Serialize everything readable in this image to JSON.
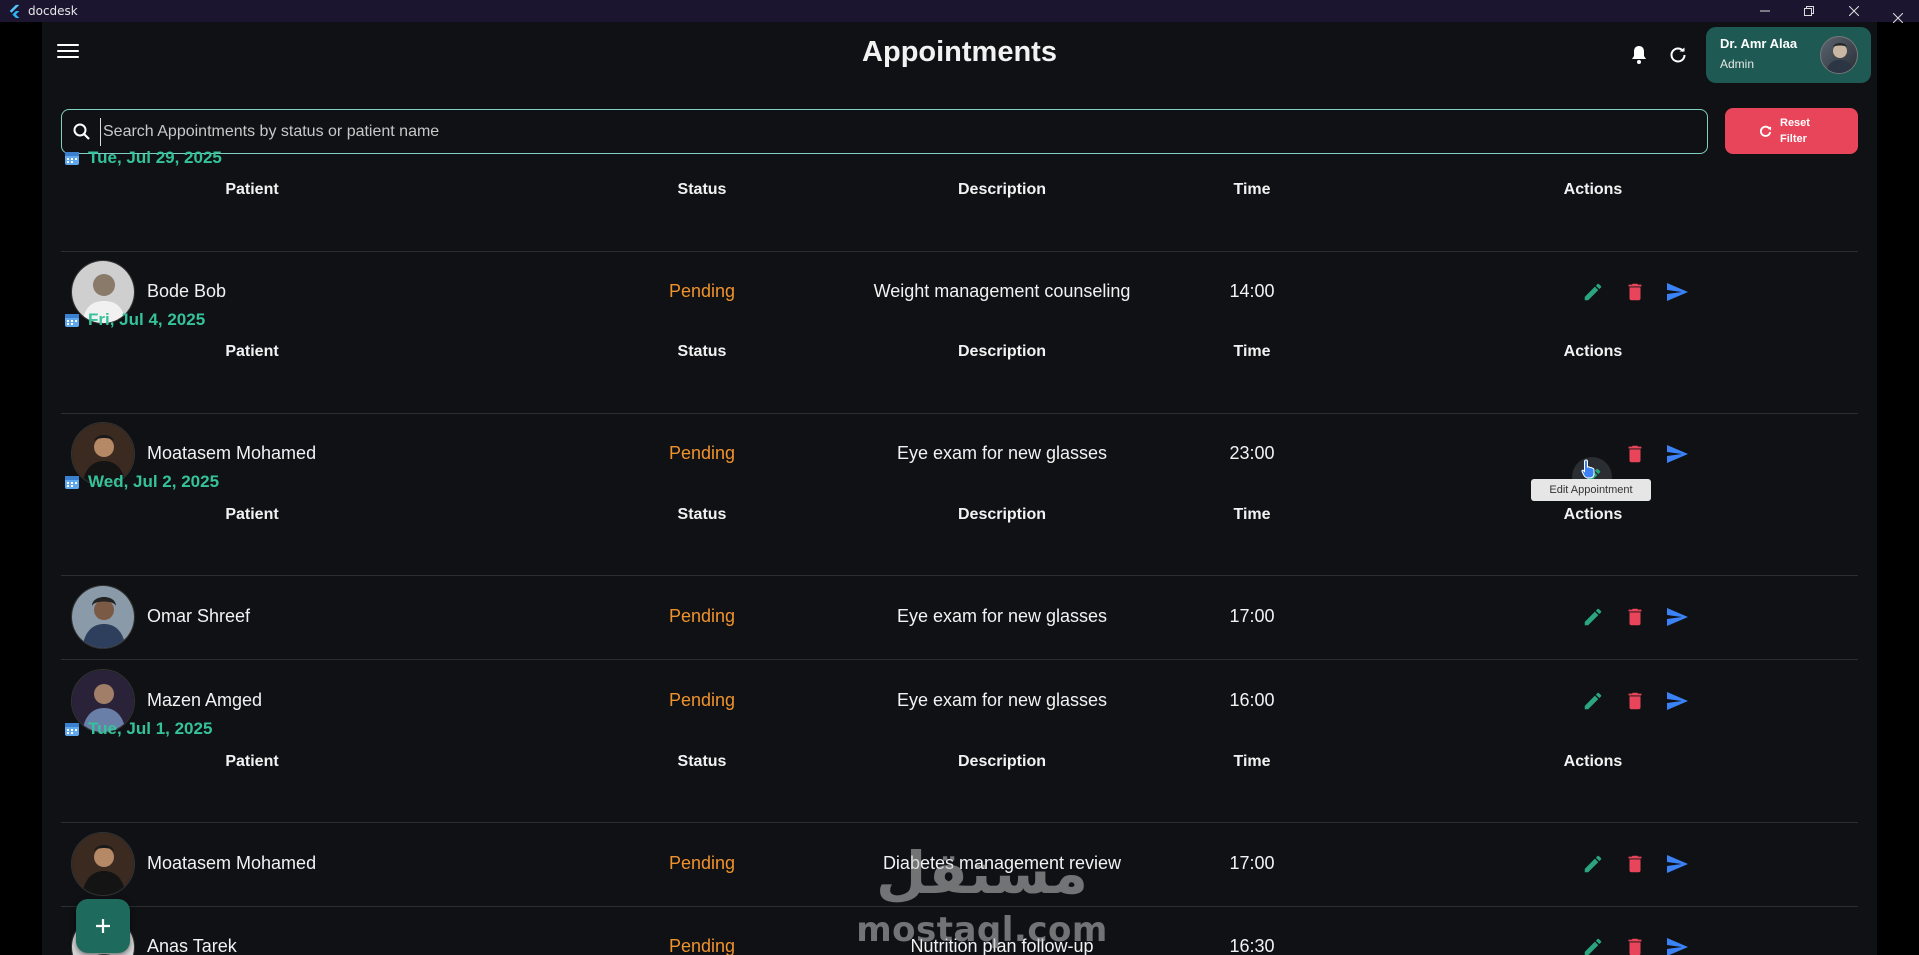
{
  "window": {
    "title": "docdesk"
  },
  "header": {
    "title": "Appointments"
  },
  "user": {
    "name": "Dr. Amr Alaa",
    "role": "Admin"
  },
  "search": {
    "placeholder": "Search Appointments by status or patient name",
    "value": ""
  },
  "reset": {
    "label_line1": "Reset",
    "label_line2": "Filter"
  },
  "columns": {
    "patient": "Patient",
    "status": "Status",
    "description": "Description",
    "time": "Time",
    "actions": "Actions"
  },
  "tooltip": "Edit Appointment",
  "watermark": {
    "arabic": "مستقل",
    "latin": "mostaql.com"
  },
  "colors": {
    "accent": "#35c29b",
    "pending": "#f0922c",
    "delete": "#e8455a",
    "send": "#3b82f6",
    "edit": "#2aa57e",
    "user_chip": "#1e5a53"
  },
  "groups": [
    {
      "date": "Tue, Jul 29, 2025",
      "rows": [
        {
          "patient": "Bode Bob",
          "status": "Pending",
          "description": "Weight management counseling",
          "time": "14:00"
        }
      ]
    },
    {
      "date": "Fri, Jul 4, 2025",
      "rows": [
        {
          "patient": "Moatasem Mohamed",
          "status": "Pending",
          "description": "Eye exam for new glasses",
          "time": "23:00"
        }
      ]
    },
    {
      "date": "Wed, Jul 2, 2025",
      "rows": [
        {
          "patient": "Omar Shreef",
          "status": "Pending",
          "description": "Eye exam for new glasses",
          "time": "17:00"
        },
        {
          "patient": "Mazen Amged",
          "status": "Pending",
          "description": "Eye exam for new glasses",
          "time": "16:00"
        }
      ]
    },
    {
      "date": "Tue, Jul 1, 2025",
      "rows": [
        {
          "patient": "Moatasem Mohamed",
          "status": "Pending",
          "description": "Diabetes management review",
          "time": "17:00"
        },
        {
          "patient": "Anas Tarek",
          "status": "Pending",
          "description": "Nutrition plan follow-up",
          "time": "16:30"
        }
      ]
    }
  ]
}
